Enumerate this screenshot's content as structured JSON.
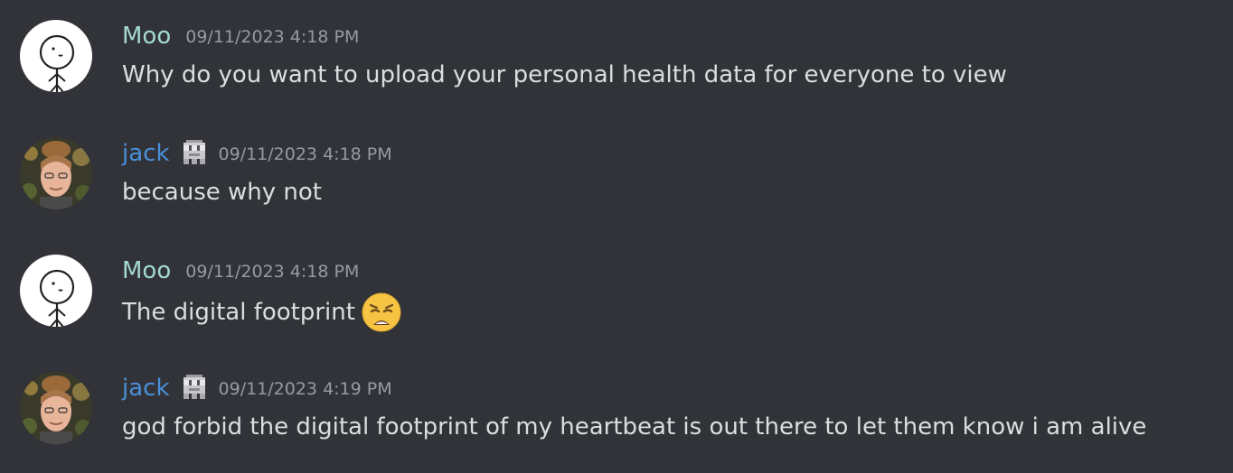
{
  "colors": {
    "background": "#313338",
    "moo_name": "#a3d9d0",
    "jack_name": "#4a90d9",
    "timestamp": "#949ba4",
    "message_text": "#dbdee1"
  },
  "messages": [
    {
      "username": "Moo",
      "name_color": "#a3d9d0",
      "avatar_icon": "stick-figure-avatar-icon",
      "badge_icon": null,
      "timestamp": "09/11/2023 4:18 PM",
      "text": "Why do you want to upload your personal health data for everyone to view",
      "emoji": null
    },
    {
      "username": "jack",
      "name_color": "#4a90d9",
      "avatar_icon": "photo-avatar-icon",
      "badge_icon": "pixel-ghost-badge-icon",
      "timestamp": "09/11/2023 4:18 PM",
      "text": "because why not",
      "emoji": null
    },
    {
      "username": "Moo",
      "name_color": "#a3d9d0",
      "avatar_icon": "stick-figure-avatar-icon",
      "badge_icon": null,
      "timestamp": "09/11/2023 4:18 PM",
      "text": "The digital footprint",
      "emoji": "weary-face-emoji-icon"
    },
    {
      "username": "jack",
      "name_color": "#4a90d9",
      "avatar_icon": "photo-avatar-icon",
      "badge_icon": "pixel-ghost-badge-icon",
      "timestamp": "09/11/2023 4:19 PM",
      "text": "god forbid the digital footprint of my heartbeat is out there to let them know i am alive",
      "emoji": null
    }
  ]
}
